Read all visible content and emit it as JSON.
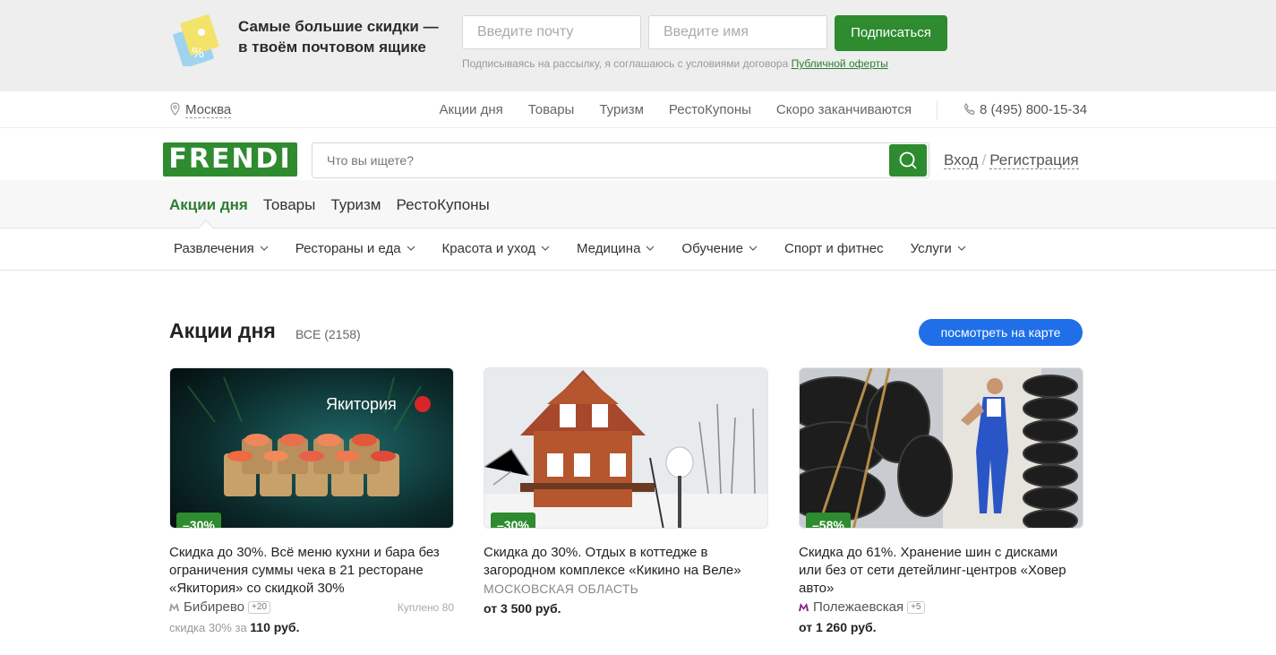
{
  "promo": {
    "title_line1": "Самые большие скидки —",
    "title_line2": "в твоём почтовом ящике",
    "email_placeholder": "Введите почту",
    "name_placeholder": "Введите имя",
    "subscribe_label": "Подписаться",
    "note_text": "Подписываясь на рассылку, я соглашаюсь с условиями договора ",
    "note_link": "Публичной оферты"
  },
  "topnav": {
    "city": "Москва",
    "links": [
      "Акции дня",
      "Товары",
      "Туризм",
      "РестоКупоны",
      "Скоро заканчиваются"
    ],
    "phone": "8 (495) 800-15-34"
  },
  "header": {
    "logo": "FRENDI",
    "search_placeholder": "Что вы ищете?",
    "login": "Вход",
    "separator": "/",
    "register": "Регистрация"
  },
  "tabs": [
    "Акции дня",
    "Товары",
    "Туризм",
    "РестоКупоны"
  ],
  "categories": [
    "Развлечения",
    "Рестораны и еда",
    "Красота и уход",
    "Медицина",
    "Обучение",
    "Спорт и фитнес",
    "Услуги"
  ],
  "section": {
    "title": "Акции дня",
    "count": "ВСЕ (2158)",
    "map_button": "посмотреть на карте"
  },
  "cards": [
    {
      "badge": "–30%",
      "image_text": "Якитория",
      "title": "Скидка до 30%. Всё меню кухни и бара без ограничения суммы чека в 21 ресторане «Якитория» со скидкой 30%",
      "metro": "Бибирево",
      "metro_more": "+20",
      "bought": "Куплено 80",
      "price_prefix": "скидка 30% за",
      "price": "110 руб."
    },
    {
      "badge": "–30%",
      "title": "Скидка до 30%. Отдых в коттедже в загородном комплексе «Кикино на Веле»",
      "region": "МОСКОВСКАЯ ОБЛАСТЬ",
      "price": "от 3 500 руб."
    },
    {
      "badge": "–58%",
      "title": "Скидка до 61%. Хранение шин с дисками или без от сети детейлинг-центров «Ховер авто»",
      "metro": "Полежаевская",
      "metro_more": "+5",
      "price": "от 1 260 руб."
    }
  ],
  "colors": {
    "green": "#2e8b2f",
    "blue": "#1f6fe8",
    "metro_purple": "#8b1a8b"
  }
}
